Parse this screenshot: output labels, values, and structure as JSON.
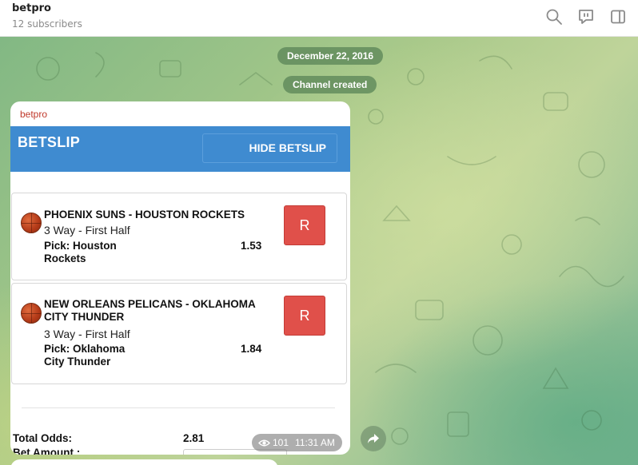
{
  "header": {
    "channel_name": "betpro",
    "subscribers": "12 subscribers",
    "icons": [
      "search-icon",
      "discussion-icon",
      "sidebar-toggle-icon"
    ]
  },
  "service": {
    "date": "December 22, 2016",
    "created": "Channel created"
  },
  "message": {
    "sender": "betpro",
    "betslip_title": "BETSLIP",
    "hide_label": "HIDE BETSLIP",
    "bets": [
      {
        "match": "PHOENIX SUNS - HOUSTON ROCKETS",
        "market": "3 Way - First Half",
        "pick_line1": "Pick: Houston",
        "pick_line2": "Rockets",
        "odds": "1.53",
        "remove_label": "R"
      },
      {
        "match": "NEW ORLEANS PELICANS - OKLAHOMA CITY THUNDER",
        "market": "3 Way - First Half",
        "pick_line1": "Pick: Oklahoma",
        "pick_line2": "City Thunder",
        "odds": "1.84",
        "remove_label": "R"
      }
    ],
    "total_odds_label": "Total Odds:",
    "total_odds_value": "2.81",
    "bet_amount_label": "Bet Amount :",
    "views": "101",
    "time": "11:31 AM"
  },
  "colors": {
    "accent_blue": "#3f8bd0",
    "remove_red": "#e0504a",
    "sender_red": "#c0392b"
  }
}
